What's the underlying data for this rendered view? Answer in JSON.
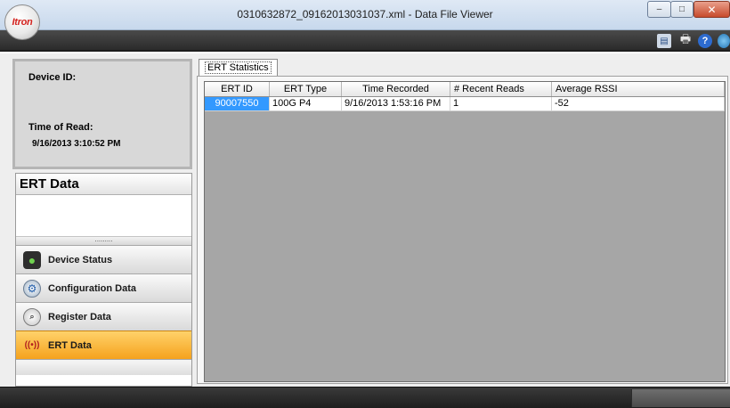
{
  "window": {
    "title": "0310632872_09162013031037.xml - Data File Viewer",
    "logo_text": "Itron",
    "controls": {
      "minimize": "–",
      "maximize": "□",
      "close": "✕"
    }
  },
  "toolbar": {
    "icons": [
      "export-icon",
      "print-icon",
      "help-icon",
      "globe-icon"
    ],
    "help_glyph": "?",
    "print_glyph": "🖶"
  },
  "device_info": {
    "device_id_label": "Device ID:",
    "time_of_read_label": "Time of Read:",
    "time_of_read_value": "9/16/2013 3:10:52 PM"
  },
  "ert_panel": {
    "header": "ERT Data",
    "splitter_dots": "........."
  },
  "nav": {
    "items": [
      {
        "label": "Device Status",
        "icon": "traffic-light-icon",
        "active": false
      },
      {
        "label": "Configuration Data",
        "icon": "gear-icon",
        "active": false
      },
      {
        "label": "Register Data",
        "icon": "register-icon",
        "active": false
      },
      {
        "label": "ERT Data",
        "icon": "antenna-icon",
        "active": true
      }
    ],
    "active_color": "#f9b83b"
  },
  "tabs": {
    "active": "ERT Statistics"
  },
  "grid": {
    "columns": [
      "ERT ID",
      "ERT Type",
      "Time Recorded",
      "# Recent Reads",
      "Average RSSI"
    ],
    "rows": [
      [
        "90007550",
        "100G P4",
        "9/16/2013 1:53:16 PM",
        "1",
        "-52"
      ]
    ],
    "selected_color": "#3399ff"
  }
}
